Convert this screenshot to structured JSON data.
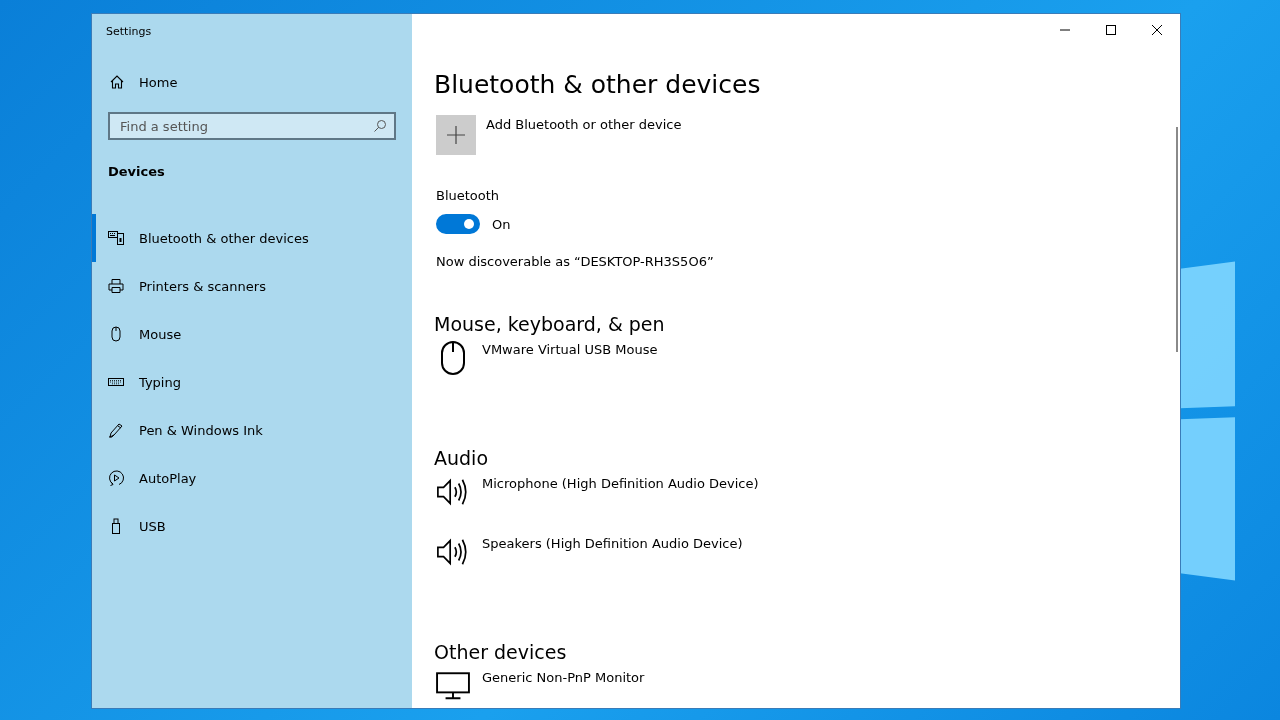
{
  "window": {
    "title": "Settings"
  },
  "sidebar": {
    "home": "Home",
    "search": {
      "placeholder": "Find a setting"
    },
    "section": "Devices",
    "items": [
      {
        "label": "Bluetooth & other devices",
        "kind": "bluetooth",
        "selected": true
      },
      {
        "label": "Printers & scanners",
        "kind": "printer",
        "selected": false
      },
      {
        "label": "Mouse",
        "kind": "mouse",
        "selected": false
      },
      {
        "label": "Typing",
        "kind": "keyboard",
        "selected": false
      },
      {
        "label": "Pen & Windows Ink",
        "kind": "pen",
        "selected": false
      },
      {
        "label": "AutoPlay",
        "kind": "autoplay",
        "selected": false
      },
      {
        "label": "USB",
        "kind": "usb",
        "selected": false
      }
    ]
  },
  "main": {
    "title": "Bluetooth & other devices",
    "add_device": "Add Bluetooth or other device",
    "bluetooth": {
      "label": "Bluetooth",
      "on": true,
      "state_text": "On"
    },
    "discoverable": "Now discoverable as “DESKTOP-RH3S5O6”",
    "groups": [
      {
        "title": "Mouse, keyboard, & pen",
        "devices": [
          {
            "name": "VMware Virtual USB Mouse",
            "kind": "mouse"
          }
        ]
      },
      {
        "title": "Audio",
        "devices": [
          {
            "name": "Microphone (High Definition Audio Device)",
            "kind": "speaker"
          },
          {
            "name": "Speakers (High Definition Audio Device)",
            "kind": "speaker"
          }
        ]
      },
      {
        "title": "Other devices",
        "devices": [
          {
            "name": "Generic Non-PnP Monitor",
            "kind": "monitor"
          }
        ]
      }
    ]
  }
}
